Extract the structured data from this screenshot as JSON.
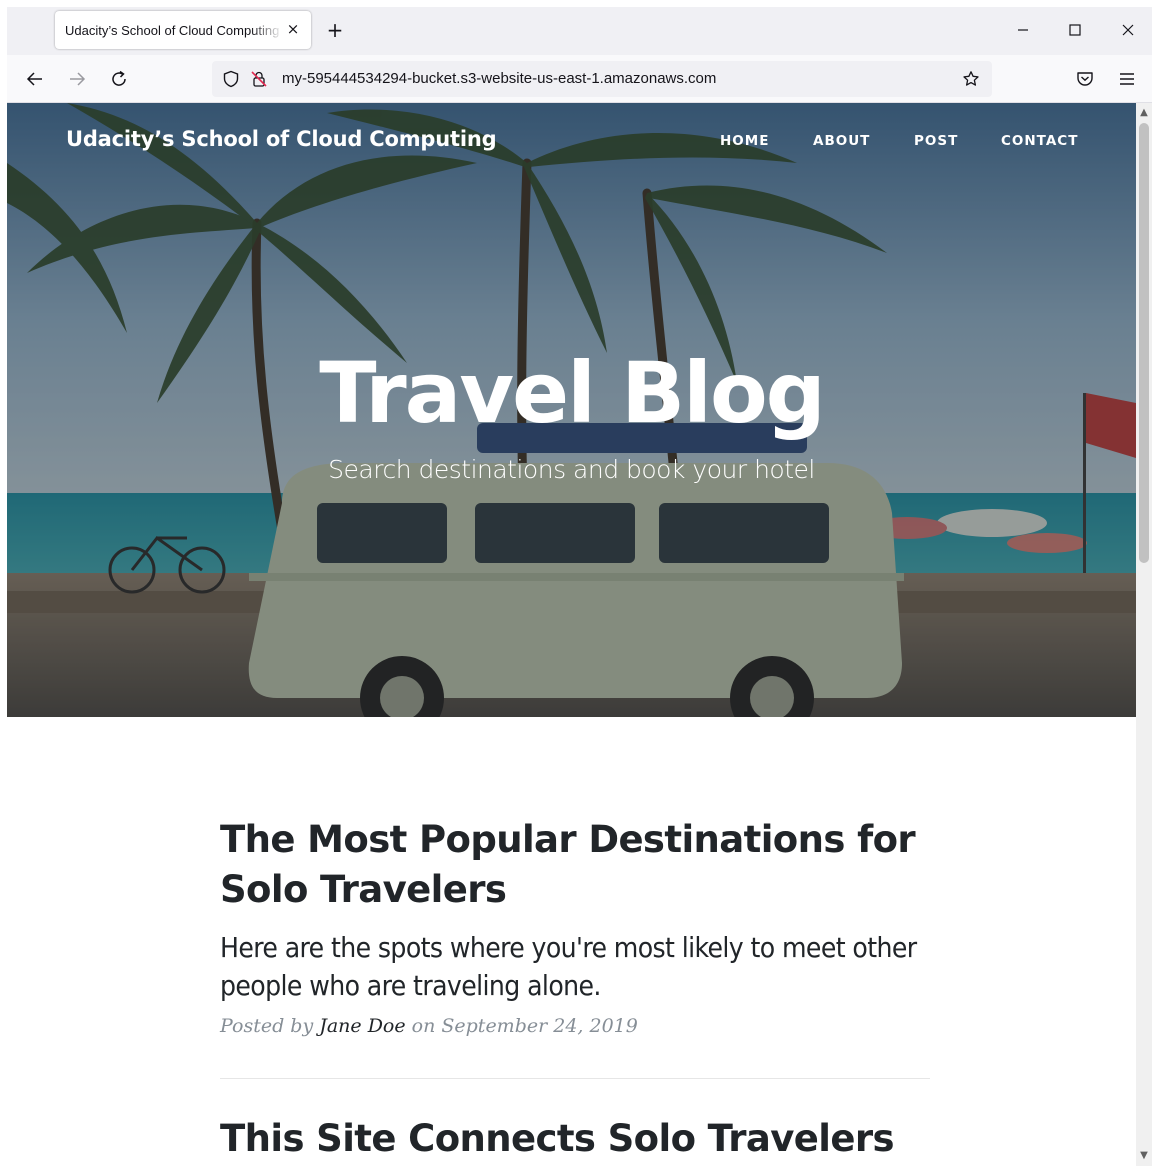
{
  "browser": {
    "tab_title": "Udacity’s School of Cloud Computing",
    "tab_close": "×",
    "new_tab": "+",
    "url": "my-595444534294-bucket.s3-website-us-east-1.amazonaws.com"
  },
  "site": {
    "brand": "Udacity’s School of Cloud Computing",
    "nav": {
      "home": "HOME",
      "about": "ABOUT",
      "post": "POST",
      "contact": "CONTACT"
    }
  },
  "hero": {
    "title": "Travel Blog",
    "subtitle": "Search destinations and book your hotel"
  },
  "posts": [
    {
      "title": "The Most Popular Destinations for Solo Travelers",
      "subtitle": "Here are the spots where you're most likely to meet other people who are traveling alone.",
      "meta_prefix": "Posted by ",
      "author": "Jane Doe",
      "meta_suffix": " on September 24, 2019"
    },
    {
      "title": "This Site Connects Solo Travelers"
    }
  ],
  "colors": {
    "chrome_bg": "#f0f0f4",
    "text_dark": "#212529",
    "meta_gray": "#868e96"
  }
}
